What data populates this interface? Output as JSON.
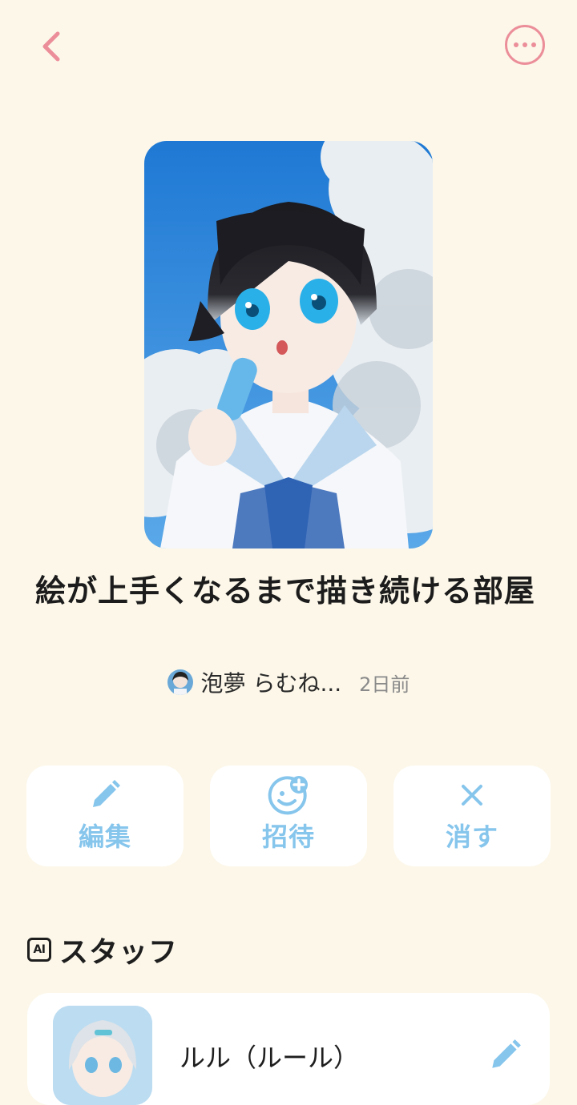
{
  "header": {
    "back_icon": "chevron-left-icon",
    "more_icon": "ellipsis-circle-icon",
    "accent_color": "#EC8E9A"
  },
  "room": {
    "title": "絵が上手くなるまで描き続ける部屋",
    "author": "泡夢 らむね...",
    "posted": "2日前"
  },
  "actions": [
    {
      "label": "編集",
      "icon": "pencil-icon"
    },
    {
      "label": "招待",
      "icon": "invite-smile-plus-icon"
    },
    {
      "label": "消す",
      "icon": "close-x-icon"
    }
  ],
  "staff": {
    "badge": "AI",
    "title": "スタッフ",
    "members": [
      {
        "name": "ルル（ルール）",
        "edit_icon": "pencil-icon"
      }
    ]
  },
  "colors": {
    "background": "#FCF7E9",
    "action_blue": "#86C5EC",
    "card": "#FFFFFF"
  }
}
